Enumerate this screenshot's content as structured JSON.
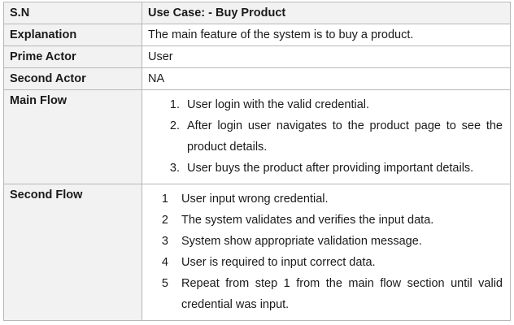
{
  "header": {
    "col1": "S.N",
    "col2": "Use Case: - Buy Product"
  },
  "rows": [
    {
      "label": "Explanation",
      "value": "The main feature of the system is to buy a product."
    },
    {
      "label": "Prime Actor",
      "value": "User"
    },
    {
      "label": "Second Actor",
      "value": "NA"
    }
  ],
  "main_flow": {
    "label": "Main Flow",
    "steps": [
      {
        "num": "1.",
        "text": "User login with the valid credential."
      },
      {
        "num": "2.",
        "text": "After login user navigates to the product page to see the product details."
      },
      {
        "num": "3.",
        "text": "User buys the product after providing important details."
      }
    ]
  },
  "second_flow": {
    "label": "Second Flow",
    "steps": [
      {
        "num": "1",
        "text": "User input wrong credential."
      },
      {
        "num": "2",
        "text": "The system validates and verifies the input data."
      },
      {
        "num": "3",
        "text": "System show appropriate validation message."
      },
      {
        "num": "4",
        "text": "User is required to input correct data."
      },
      {
        "num": "5",
        "text": "Repeat from step 1 from the main flow section until valid credential was input."
      }
    ]
  }
}
